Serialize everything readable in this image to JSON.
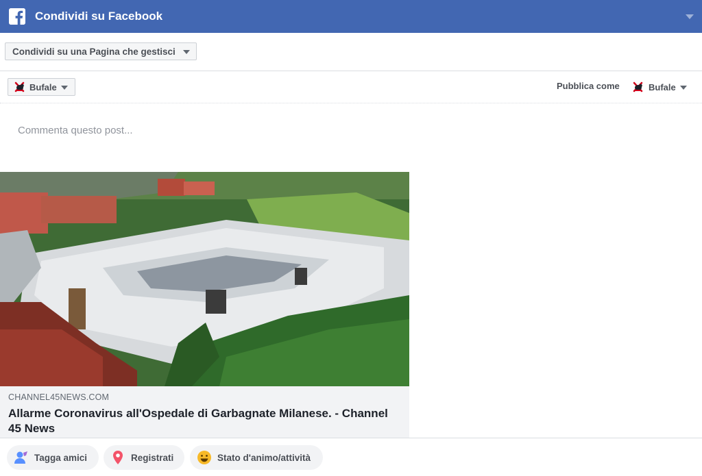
{
  "header": {
    "title": "Condividi su Facebook",
    "brand_color": "#4267b2",
    "logo_icon": "facebook-logo-icon",
    "menu_icon": "chevron-down-icon"
  },
  "destination": {
    "selected": "Condividi su una Pagina che gestisci"
  },
  "page_selector": {
    "selected": "Bufale",
    "icon": "page-avatar-icon"
  },
  "publish_as": {
    "label": "Pubblica come",
    "page_name": "Bufale"
  },
  "comment": {
    "placeholder": "Commenta questo post..."
  },
  "link_preview": {
    "image_icon": "hospital-aerial-photo",
    "domain": "CHANNEL45NEWS.COM",
    "title": "Allarme Coronavirus all'Ospedale di Garbagnate Milanese. - Channel 45 News"
  },
  "footer": {
    "tag_friends": "Tagga amici",
    "check_in": "Registrati",
    "feeling": "Stato d'animo/attività"
  }
}
